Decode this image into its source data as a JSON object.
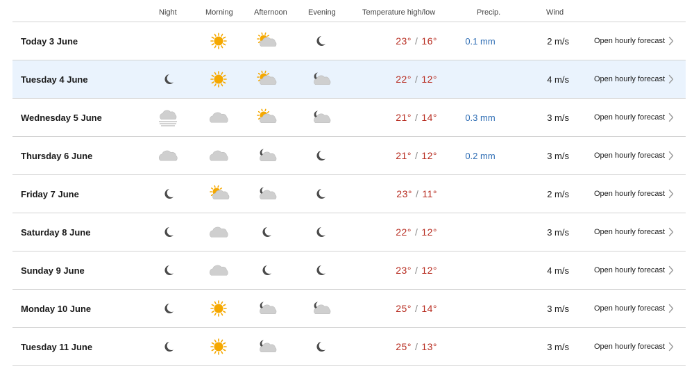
{
  "header": {
    "night": "Night",
    "morning": "Morning",
    "afternoon": "Afternoon",
    "evening": "Evening",
    "temperature": "Temperature high/low",
    "precip": "Precip.",
    "wind": "Wind"
  },
  "colors": {
    "temp": "#b72b1f",
    "precip": "#2e6db4",
    "selected_row": "#eaf3fd",
    "sun": "#f5a800",
    "cloud": "#cfcfcf",
    "moon": "#4a4a4a"
  },
  "days": [
    {
      "day": "Today 3 June",
      "icons": [
        "",
        "sun",
        "sun-cloud",
        "moon"
      ],
      "high": "23°",
      "low": "16°",
      "precip": "0.1 mm",
      "wind": "2 m/s",
      "link": "Open hourly forecast"
    },
    {
      "day": "Tuesday 4 June",
      "icons": [
        "moon",
        "sun",
        "sun-cloud",
        "moon-cloud"
      ],
      "high": "22°",
      "low": "12°",
      "precip": "",
      "wind": "4 m/s",
      "link": "Open hourly forecast"
    },
    {
      "day": "Wednesday 5 June",
      "icons": [
        "fog",
        "cloud",
        "sun-cloud",
        "moon-cloud"
      ],
      "high": "21°",
      "low": "14°",
      "precip": "0.3 mm",
      "wind": "3 m/s",
      "link": "Open hourly forecast"
    },
    {
      "day": "Thursday 6 June",
      "icons": [
        "cloud",
        "cloud",
        "moon-cloud",
        "moon"
      ],
      "high": "21°",
      "low": "12°",
      "precip": "0.2 mm",
      "wind": "3 m/s",
      "link": "Open hourly forecast"
    },
    {
      "day": "Friday 7 June",
      "icons": [
        "moon",
        "sun-cloud",
        "moon-cloud",
        "moon"
      ],
      "high": "23°",
      "low": "11°",
      "precip": "",
      "wind": "2 m/s",
      "link": "Open hourly forecast"
    },
    {
      "day": "Saturday 8 June",
      "icons": [
        "moon",
        "cloud",
        "moon",
        "moon"
      ],
      "high": "22°",
      "low": "12°",
      "precip": "",
      "wind": "3 m/s",
      "link": "Open hourly forecast"
    },
    {
      "day": "Sunday 9 June",
      "icons": [
        "moon",
        "cloud",
        "moon",
        "moon"
      ],
      "high": "23°",
      "low": "12°",
      "precip": "",
      "wind": "4 m/s",
      "link": "Open hourly forecast"
    },
    {
      "day": "Monday 10 June",
      "icons": [
        "moon",
        "sun",
        "moon-cloud",
        "moon-cloud"
      ],
      "high": "25°",
      "low": "14°",
      "precip": "",
      "wind": "3 m/s",
      "link": "Open hourly forecast"
    },
    {
      "day": "Tuesday 11 June",
      "icons": [
        "moon",
        "sun",
        "moon-cloud",
        "moon"
      ],
      "high": "25°",
      "low": "13°",
      "precip": "",
      "wind": "3 m/s",
      "link": "Open hourly forecast"
    }
  ]
}
